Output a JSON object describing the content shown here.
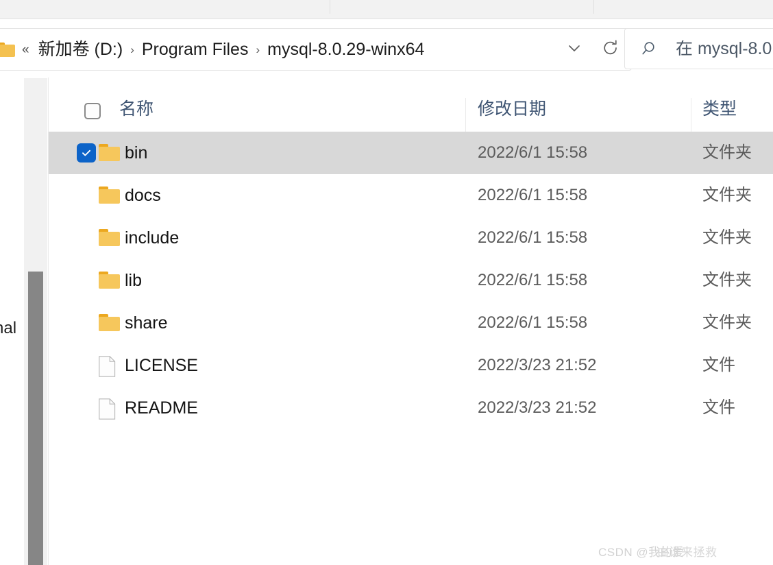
{
  "window": {
    "type": "file-explorer"
  },
  "toolbar": {
    "separators": 2
  },
  "address_bar": {
    "folder_icon": "folder-icon",
    "overflow_chevrons": "«",
    "breadcrumbs": [
      {
        "label": "新加卷 (D:)"
      },
      {
        "label": "Program Files"
      },
      {
        "label": "mysql-8.0.29-winx64"
      }
    ],
    "separator": "›",
    "dropdown_icon": "chevron-down-icon",
    "refresh_icon": "refresh-icon"
  },
  "search": {
    "icon": "search-icon",
    "placeholder": "在 mysql-8.0"
  },
  "navigation_pane": {
    "cut_off_text": "nal",
    "scrollbar": "vertical-scrollbar"
  },
  "file_list": {
    "sort_indicator": "^",
    "header_checkbox": "unchecked",
    "columns": [
      {
        "key": "name",
        "label": "名称"
      },
      {
        "key": "date",
        "label": "修改日期"
      },
      {
        "key": "type",
        "label": "类型"
      }
    ],
    "rows": [
      {
        "name": "bin",
        "date": "2022/6/1 15:58",
        "type": "文件夹",
        "icon": "folder-icon",
        "selected": true,
        "checked": true
      },
      {
        "name": "docs",
        "date": "2022/6/1 15:58",
        "type": "文件夹",
        "icon": "folder-icon",
        "selected": false,
        "checked": false
      },
      {
        "name": "include",
        "date": "2022/6/1 15:58",
        "type": "文件夹",
        "icon": "folder-icon",
        "selected": false,
        "checked": false
      },
      {
        "name": "lib",
        "date": "2022/6/1 15:58",
        "type": "文件夹",
        "icon": "folder-icon",
        "selected": false,
        "checked": false
      },
      {
        "name": "share",
        "date": "2022/6/1 15:58",
        "type": "文件夹",
        "icon": "folder-icon",
        "selected": false,
        "checked": false
      },
      {
        "name": "LICENSE",
        "date": "2022/3/23 21:52",
        "type": "文件",
        "icon": "document-icon",
        "selected": false,
        "checked": false
      },
      {
        "name": "README",
        "date": "2022/3/23 21:52",
        "type": "文件",
        "icon": "document-icon",
        "selected": false,
        "checked": false
      }
    ]
  },
  "watermark": {
    "text": "CSDN @我的爱",
    "overlap_text": "由谁来拯救"
  },
  "colors": {
    "selection_row": "#d8d8d8",
    "checkbox_checked": "#0c63c8",
    "folder_tab": "#eca820",
    "folder_body": "#f6c75c",
    "header_text": "#3f5573",
    "secondary_text": "#5b5b5b"
  }
}
